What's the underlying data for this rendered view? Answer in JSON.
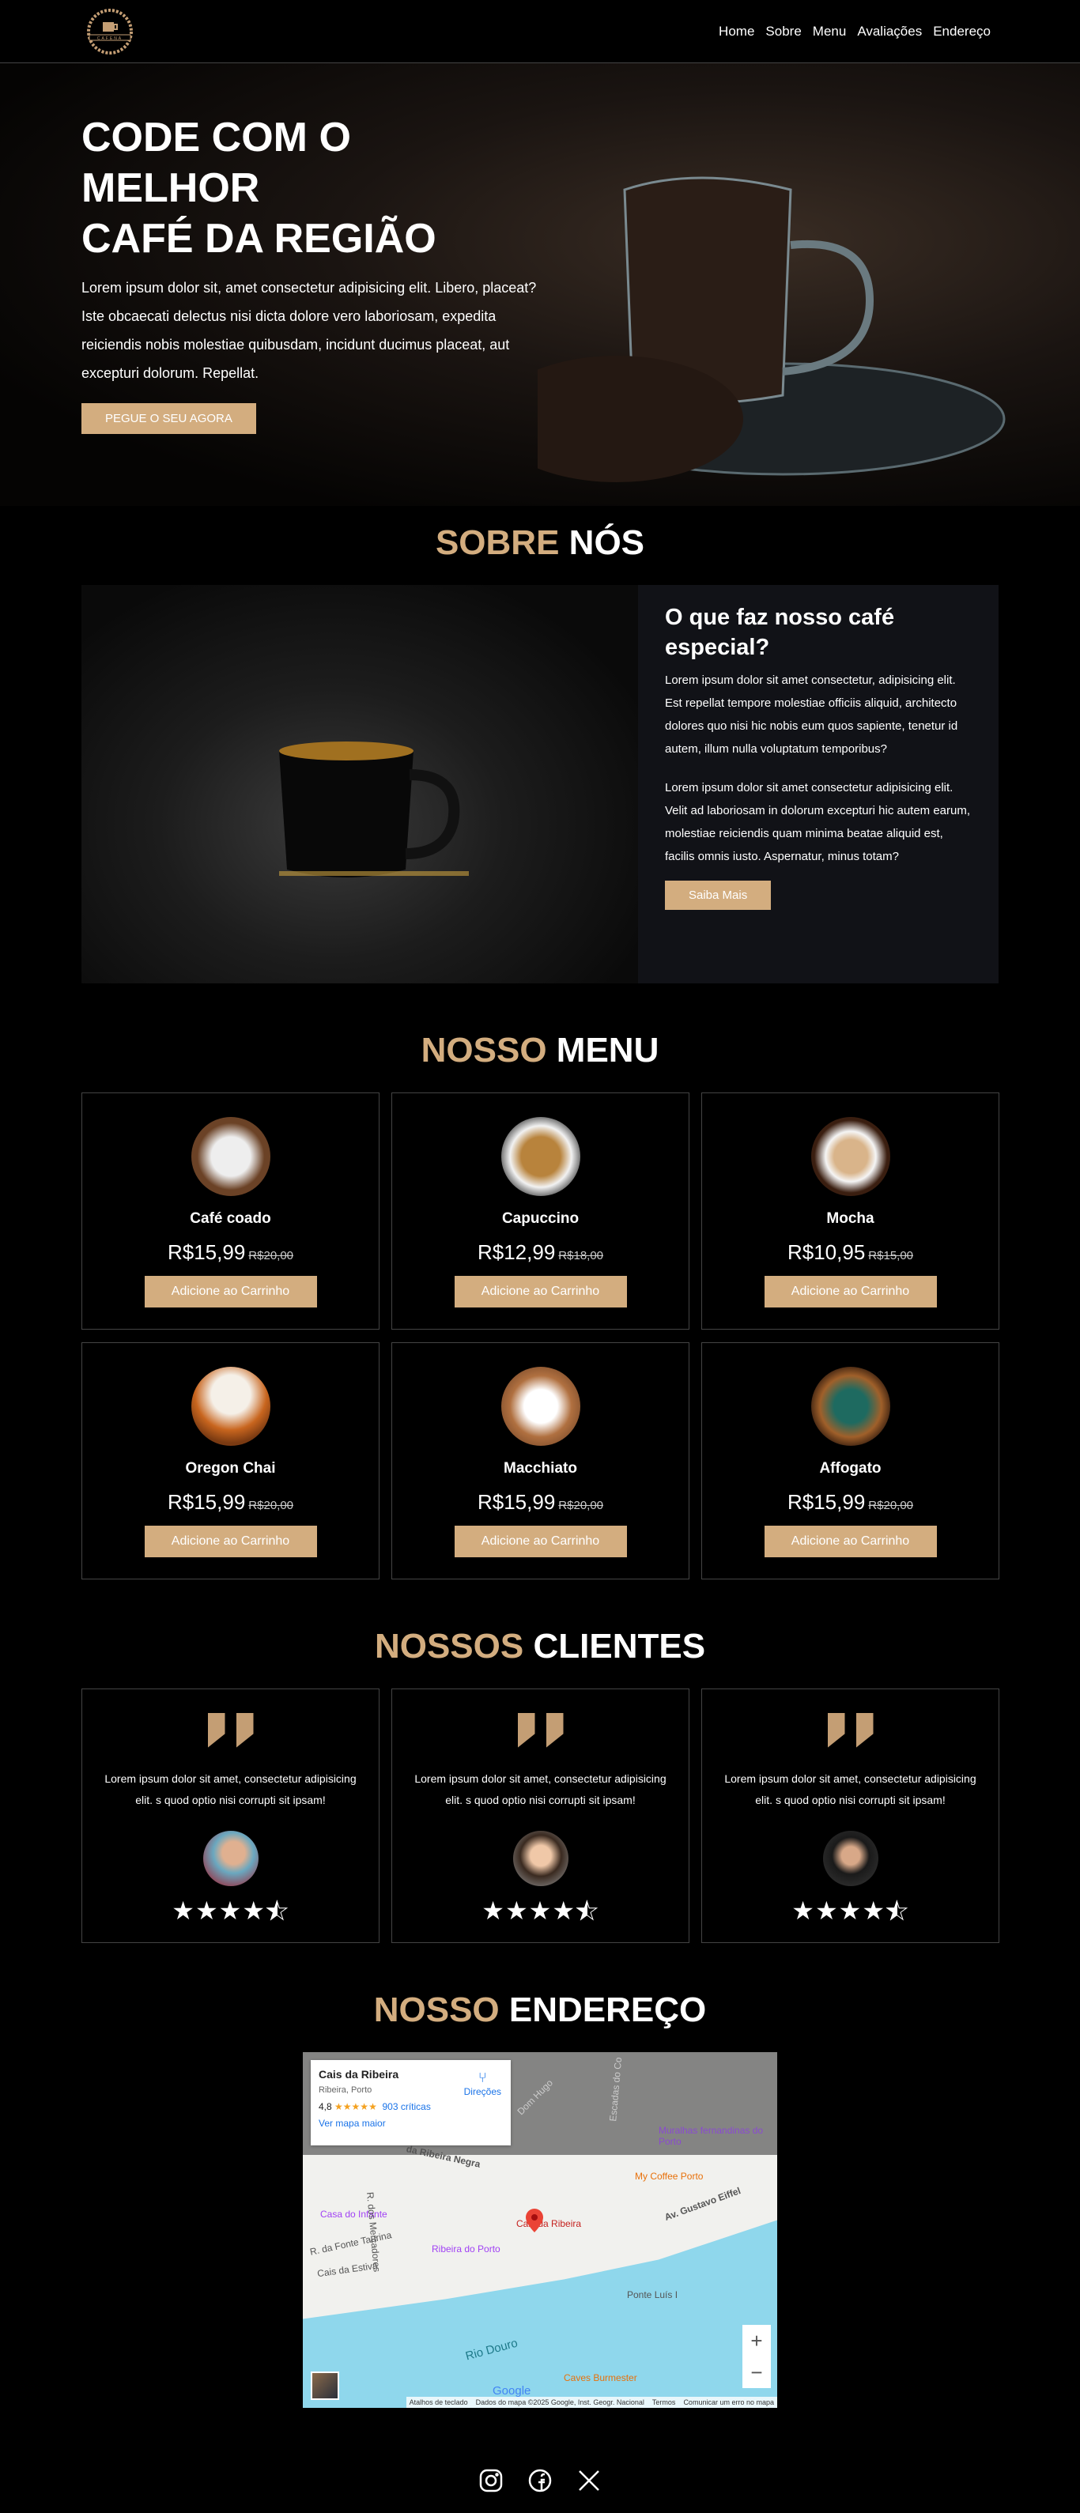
{
  "nav": {
    "logo_text": "CAFENA",
    "links": [
      "Home",
      "Sobre",
      "Menu",
      "Avaliações",
      "Endereço"
    ]
  },
  "hero": {
    "title_line1": "CODE COM O MELHOR",
    "title_line2": "CAFÉ DA REGIÃO",
    "text": "Lorem ipsum dolor sit, amet consectetur adipisicing elit. Libero, placeat? Iste obcaecati delectus nisi dicta dolore vero laboriosam, expedita reiciendis nobis molestiae quibusdam, incidunt ducimus placeat, aut excepturi dolorum. Repellat.",
    "cta": "Pegue o seu agora"
  },
  "about": {
    "title_accent": "Sobre",
    "title_rest": "Nós",
    "heading": "O que faz nosso café especial?",
    "p1": "Lorem ipsum dolor sit amet consectetur, adipisicing elit. Est repellat tempore molestiae officiis aliquid, architecto dolores quo nisi hic nobis eum quos sapiente, tenetur id autem, illum nulla voluptatum temporibus?",
    "p2": "Lorem ipsum dolor sit amet consectetur adipisicing elit. Velit ad laboriosam in dolorum excepturi hic autem earum, molestiae reiciendis quam minima beatae aliquid est, facilis omnis iusto. Aspernatur, minus totam?",
    "button": "Saiba Mais"
  },
  "menu": {
    "title_accent": "Nosso",
    "title_rest": "Menu",
    "button": "Adicione ao Carrinho",
    "items": [
      {
        "name": "Café coado",
        "price": "R$15,99",
        "old": "R$20,00"
      },
      {
        "name": "Capuccino",
        "price": "R$12,99",
        "old": "R$18,00"
      },
      {
        "name": "Mocha",
        "price": "R$10,95",
        "old": "R$15,00"
      },
      {
        "name": "Oregon Chai",
        "price": "R$15,99",
        "old": "R$20,00"
      },
      {
        "name": "Macchiato",
        "price": "R$15,99",
        "old": "R$20,00"
      },
      {
        "name": "Affogato",
        "price": "R$15,99",
        "old": "R$20,00"
      }
    ]
  },
  "reviews": {
    "title_accent": "Nossos",
    "title_rest": "Clientes",
    "items": [
      {
        "text": "Lorem ipsum dolor sit amet, consectetur adipisicing elit. s quod optio nisi corrupti sit ipsam!",
        "rating": 4.5
      },
      {
        "text": "Lorem ipsum dolor sit amet, consectetur adipisicing elit. s quod optio nisi corrupti sit ipsam!",
        "rating": 4.5
      },
      {
        "text": "Lorem ipsum dolor sit amet, consectetur adipisicing elit. s quod optio nisi corrupti sit ipsam!",
        "rating": 4.5
      }
    ]
  },
  "address": {
    "title_accent": "Nosso",
    "title_rest": "Endereço",
    "map": {
      "place": "Cais da Ribeira",
      "area": "Ribeira, Porto",
      "rating": "4,8",
      "stars": "★★★★★",
      "reviews": "903 críticas",
      "larger": "Ver mapa maior",
      "directions": "Direções",
      "labels": [
        "Muralhas fernandinas do Porto",
        "My Coffee Porto",
        "Av. Gustavo Eiffel",
        "Casa do Infante",
        "Cais da Ribeira",
        "Ribeira do Porto",
        "R. da Fonte Taurina",
        "Cais da Estiva",
        "R. dos Mercadores",
        "Ponte Luís I",
        "Rio Douro",
        "Caves Burmester",
        "da Ribeira Negra",
        "Dom Hugo",
        "Escadas do Co"
      ],
      "google": "Google",
      "attribution": [
        "Atalhos de teclado",
        "Dados do mapa ©2025 Google, Inst. Geogr. Nacional",
        "Termos",
        "Comunicar um erro no mapa"
      ]
    }
  },
  "footer": {
    "icons": [
      "instagram-icon",
      "facebook-icon",
      "x-icon"
    ]
  },
  "colors": {
    "accent": "#d3ad7f",
    "panel": "#111217",
    "border": "#444444"
  }
}
